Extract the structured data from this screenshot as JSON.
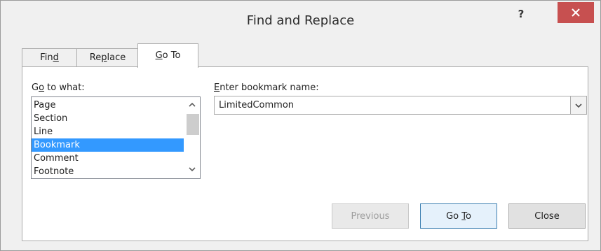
{
  "window": {
    "title": "Find and Replace",
    "help_label": "?"
  },
  "tabs": [
    {
      "pre": "Fin",
      "key": "d",
      "post": "",
      "active": false
    },
    {
      "pre": "Re",
      "key": "p",
      "post": "lace",
      "active": false
    },
    {
      "pre": "",
      "key": "G",
      "post": "o To",
      "active": true
    }
  ],
  "goto_what": {
    "label_pre": "G",
    "label_key": "o",
    "label_post": " to what:",
    "items": [
      "Page",
      "Section",
      "Line",
      "Bookmark",
      "Comment",
      "Footnote"
    ],
    "selected": "Bookmark"
  },
  "bookmark": {
    "label_pre": "",
    "label_key": "E",
    "label_post": "nter bookmark name:",
    "value": "LimitedCommon"
  },
  "buttons": {
    "previous": "Previous",
    "goto_pre": "Go ",
    "goto_key": "T",
    "goto_post": "o",
    "close": "Close"
  },
  "colors": {
    "close_button": "#c75050",
    "selection": "#3399ff",
    "default_button_border": "#3c7fb1"
  },
  "icons": {
    "close": "close-icon",
    "scroll_up": "chevron-up-icon",
    "scroll_down": "chevron-down-icon",
    "dropdown": "chevron-down-icon"
  }
}
